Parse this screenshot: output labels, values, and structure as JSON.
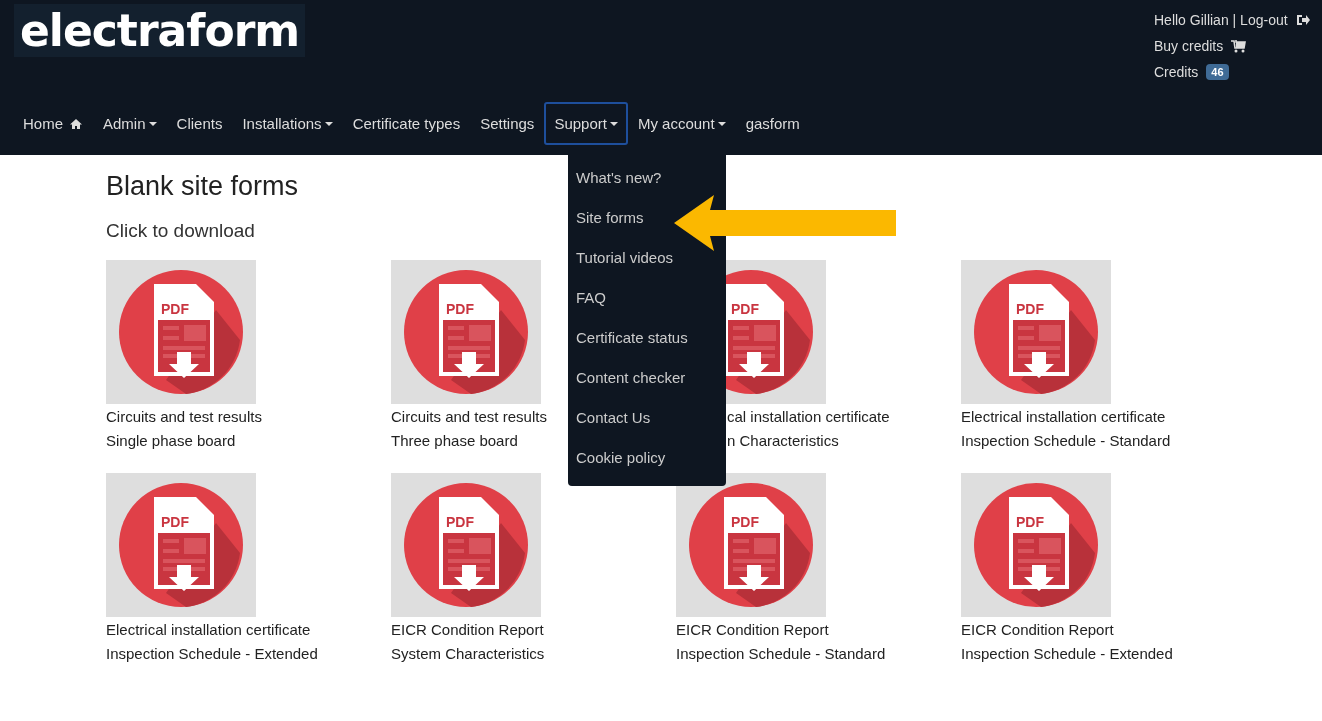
{
  "logo": {
    "text": "electraform"
  },
  "user": {
    "greeting": "Hello Gillian | Log-out",
    "buy": "Buy credits",
    "credits_label": "Credits",
    "credits": "46"
  },
  "nav": [
    {
      "label": "Home",
      "kind": "home",
      "selected": false
    },
    {
      "label": "Admin",
      "kind": "dropdown",
      "selected": false
    },
    {
      "label": "Clients",
      "kind": "link",
      "selected": false
    },
    {
      "label": "Installations",
      "kind": "dropdown",
      "selected": false
    },
    {
      "label": "Certificate types",
      "kind": "link",
      "selected": false
    },
    {
      "label": "Settings",
      "kind": "link",
      "selected": false
    },
    {
      "label": "Support",
      "kind": "dropdown",
      "selected": true
    },
    {
      "label": "My account",
      "kind": "dropdown",
      "selected": false
    },
    {
      "label": "gasform",
      "kind": "link",
      "selected": false
    }
  ],
  "menu": [
    "What's new?",
    "Site forms",
    "Tutorial videos",
    "FAQ",
    "Certificate status",
    "Content checker",
    "Contact Us",
    "Cookie policy"
  ],
  "title": "Blank site forms",
  "subtitle": "Click to download",
  "forms": [
    {
      "badge": "PDF",
      "lines": [
        "Circuits and test results",
        "Single phase board"
      ],
      "covered": false
    },
    {
      "badge": "PDF",
      "lines": [
        "Circuits and test results",
        "Three phase board"
      ],
      "covered": false
    },
    {
      "badge": "PDF",
      "lines": [
        "cal installation certificate",
        "n Characteristics"
      ],
      "covered": true
    },
    {
      "badge": "PDF",
      "lines": [
        "Electrical installation certificate",
        "Inspection Schedule - Standard"
      ],
      "covered": false
    },
    {
      "badge": "PDF",
      "lines": [
        "Electrical installation certificate",
        "Inspection Schedule - Extended"
      ],
      "covered": false
    },
    {
      "badge": "PDF",
      "lines": [
        "EICR Condition Report",
        "System Characteristics"
      ],
      "covered": false
    },
    {
      "badge": "PDF",
      "lines": [
        "EICR Condition Report",
        "Inspection Schedule - Standard"
      ],
      "covered": false
    },
    {
      "badge": "PDF",
      "lines": [
        "EICR Condition Report",
        "Inspection Schedule - Extended"
      ],
      "covered": false
    }
  ]
}
